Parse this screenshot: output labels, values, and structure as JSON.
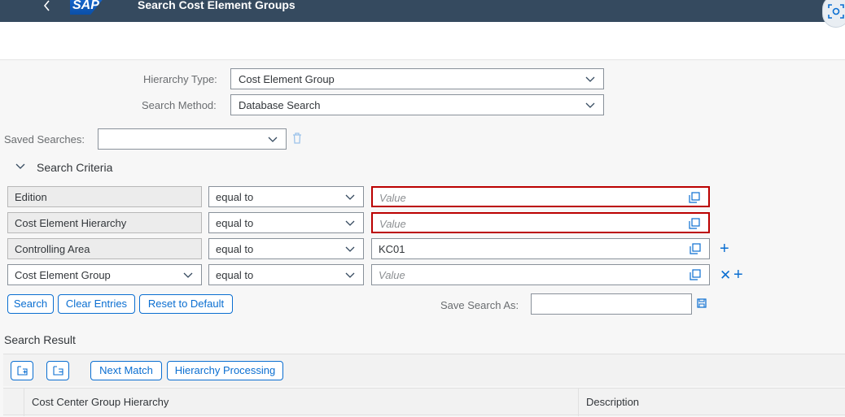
{
  "shell": {
    "logo": "SAP",
    "title": "Search Cost Element Groups"
  },
  "form": {
    "hierarchy_type_label": "Hierarchy Type:",
    "hierarchy_type_value": "Cost Element Group",
    "search_method_label": "Search Method:",
    "search_method_value": "Database Search",
    "saved_searches_label": "Saved Searches:",
    "saved_searches_value": ""
  },
  "criteria": {
    "section_label": "Search Criteria",
    "rows": [
      {
        "field": "Edition",
        "operator": "equal to",
        "value": "",
        "placeholder": "Value",
        "error": true
      },
      {
        "field": "Cost Element Hierarchy",
        "operator": "equal to",
        "value": "",
        "placeholder": "Value",
        "error": true
      },
      {
        "field": "Controlling Area",
        "operator": "equal to",
        "value": "KC01",
        "placeholder": "Value",
        "error": false
      },
      {
        "field": "Cost Element Group",
        "operator": "equal to",
        "value": "",
        "placeholder": "Value",
        "error": false
      }
    ]
  },
  "actions": {
    "search": "Search",
    "clear": "Clear Entries",
    "reset": "Reset to Default",
    "save_search_as_label": "Save Search As:",
    "save_search_as_value": ""
  },
  "result": {
    "title": "Search Result",
    "next_match": "Next Match",
    "hierarchy_processing": "Hierarchy Processing",
    "columns": [
      "Cost Center Group Hierarchy",
      "Description"
    ]
  },
  "colors": {
    "shell": "#354a5f",
    "accent": "#0a6ed1",
    "error": "#bb0000"
  }
}
